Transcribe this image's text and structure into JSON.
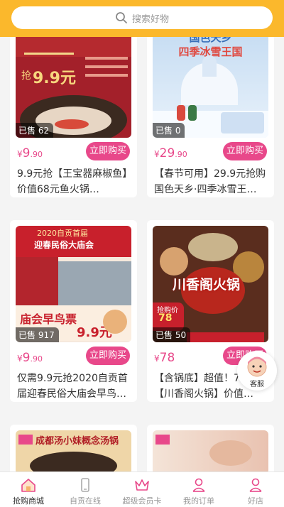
{
  "search": {
    "placeholder": "搜索好物"
  },
  "cards": [
    {
      "sold": "已售 62",
      "price_main": "9",
      "price_dec": ".90",
      "buy": "立即购买",
      "title": "9.9元抢【王宝器麻椒鱼】价值68元鱼火锅…"
    },
    {
      "sold": "已售 0",
      "price_main": "29",
      "price_dec": ".90",
      "buy": "立即购买",
      "title": "【春节可用】29.9元抢购国色天乡·四季冰雪王…"
    },
    {
      "sold": "已售 917",
      "price_main": "9",
      "price_dec": ".90",
      "buy": "立即购买",
      "title": "仅需9.9元抢2020自贡首届迎春民俗大庙会早鸟…"
    },
    {
      "sold": "已售 50",
      "price_main": "78",
      "price_dec": "",
      "buy": "立即购买",
      "title": "【含锅底】超值！78元抢【川香阁火锅】价值…"
    }
  ],
  "currency": "¥",
  "poster_text": {
    "c1_main": "9.9元",
    "c1_sub": "抢",
    "c2_top": "国色天乡",
    "c2_mid": "四季冰雪王国",
    "c3_top": "2020自贡首届",
    "c3_mid": "迎春民俗大庙会",
    "c3_bottom": "庙会早鸟票",
    "c3_price": "9.9元",
    "c4_mid": "川香阁火锅",
    "c4_tag": "抢购价",
    "c4_price": "78",
    "c5_top": "成都汤小妹概念汤锅"
  },
  "service": {
    "label": "客服"
  },
  "tabs": [
    {
      "label": "抢购商城",
      "icon": "home-icon"
    },
    {
      "label": "自贡在线",
      "icon": "phone-icon"
    },
    {
      "label": "超级会员卡",
      "icon": "crown-icon"
    },
    {
      "label": "我的订单",
      "icon": "user-icon"
    },
    {
      "label": "好店",
      "icon": "user-icon"
    }
  ]
}
